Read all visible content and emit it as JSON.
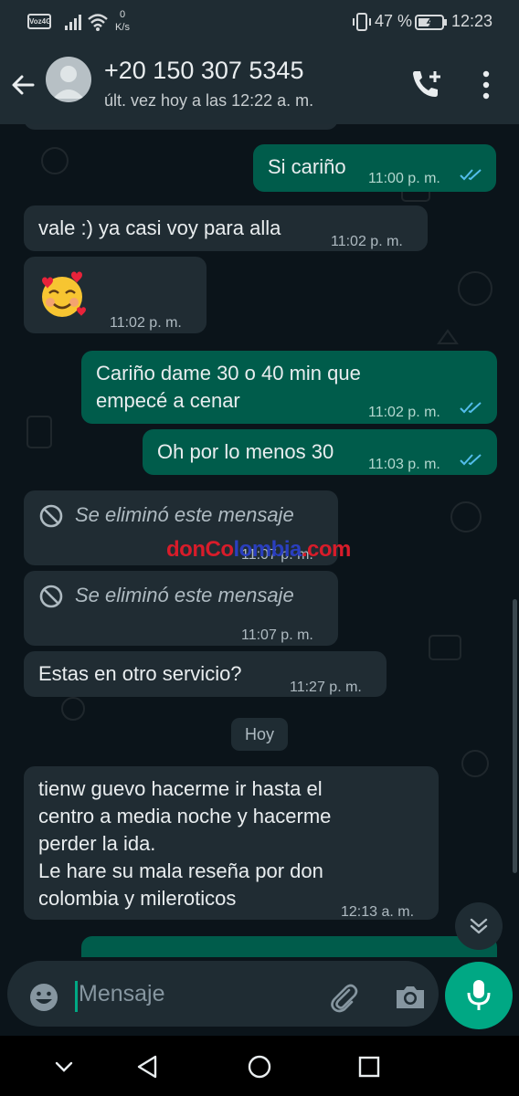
{
  "status_bar": {
    "carrier_badge": "Voz4G",
    "data_rate_value": "0",
    "data_rate_unit": "K/s",
    "battery_percent": "47 %",
    "time": "12:23"
  },
  "header": {
    "contact_name": "+20 150 307 5345",
    "last_seen": "últ. vez hoy a las 12:22 a. m."
  },
  "messages": [
    {
      "direction": "out",
      "text": "Si cariño",
      "time": "11:00 p. m.",
      "status": "read"
    },
    {
      "direction": "in",
      "text": "vale :) ya casi voy para alla",
      "time": "11:02 p. m."
    },
    {
      "direction": "in",
      "emoji": "smiling-face-with-hearts",
      "time": "11:02 p. m."
    },
    {
      "direction": "out",
      "lines": [
        "Cariño dame 30 o 40 min que",
        "empecé a cenar"
      ],
      "time": "11:02 p. m.",
      "status": "read"
    },
    {
      "direction": "out",
      "text": "Oh por lo menos 30",
      "time": "11:03 p. m.",
      "status": "read"
    },
    {
      "direction": "in",
      "deleted": true,
      "text": "Se eliminó este mensaje",
      "time": "11:07 p. m."
    },
    {
      "direction": "in",
      "deleted": true,
      "text": "Se eliminó este mensaje",
      "time": "11:07 p. m."
    },
    {
      "direction": "in",
      "text": "Estas en otro servicio?",
      "time": "11:27 p. m."
    },
    {
      "direction": "in",
      "lines": [
        "tienw guevo hacerme ir hasta el",
        "centro a media noche y hacerme",
        "perder la ida.",
        "Le hare su mala reseña por don",
        "colombia y mileroticos"
      ],
      "time": "12:13 a. m."
    }
  ],
  "day_divider": "Hoy",
  "watermark": {
    "part1": "donCo",
    "part2": "lombia",
    "part3": ".com"
  },
  "composer": {
    "placeholder": "Mensaje"
  },
  "colors": {
    "background": "#0b141a",
    "incoming_bubble": "#202c33",
    "outgoing_bubble": "#005c4b",
    "accent": "#00a884",
    "read_ticks": "#53bdeb"
  }
}
